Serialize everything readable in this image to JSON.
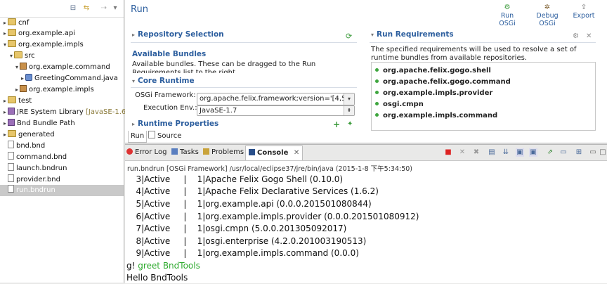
{
  "explorer": {
    "items": [
      {
        "label": "cnf"
      },
      {
        "label": "org.example.api"
      },
      {
        "label": "org.example.impls"
      },
      {
        "label": "src"
      },
      {
        "label": "org.example.command"
      },
      {
        "label": "GreetingCommand.java"
      },
      {
        "label": "org.example.impls"
      },
      {
        "label": "test"
      },
      {
        "label": "JRE System Library",
        "suffix": "[JavaSE-1.6"
      },
      {
        "label": "Bnd Bundle Path"
      },
      {
        "label": "generated"
      },
      {
        "label": "bnd.bnd"
      },
      {
        "label": "command.bnd"
      },
      {
        "label": "launch.bndrun"
      },
      {
        "label": "provider.bnd"
      },
      {
        "label": "run.bndrun"
      }
    ]
  },
  "editor": {
    "title": "Run",
    "buttons": {
      "run": "Run OSGi",
      "debug": "Debug OSGi",
      "export": "Export"
    },
    "repository_selection": "Repository Selection",
    "available_bundles_title": "Available Bundles",
    "available_bundles_desc": "Available bundles. These can be dragged to the Run Requirements list to the right.",
    "core_runtime": "Core Runtime",
    "osgi_framework_label": "OSGi Framework:",
    "osgi_framework_value": "org.apache.felix.framework;version='[4,5)'",
    "execution_env_label": "Execution Env.:",
    "execution_env_value": "JavaSE-1.7",
    "runtime_properties": "Runtime Properties",
    "run_requirements": "Run Requirements",
    "run_requirements_desc": "The specified requirements will be used to resolve a set of runtime bundles from available repositories.",
    "requirements": [
      "org.apache.felix.gogo.shell",
      "org.apache.felix.gogo.command",
      "org.example.impls.provider",
      "osgi.cmpn",
      "org.example.impls.command"
    ],
    "tabs": {
      "run": "Run",
      "source": "Source"
    }
  },
  "console": {
    "tabs": {
      "error_log": "Error Log",
      "tasks": "Tasks",
      "problems": "Problems",
      "console": "Console"
    },
    "process": "run.bndrun [OSGi Framework] /usr/local/eclipse37/jre/bin/java (2015-1-8 下午5:34:50)",
    "lines": [
      "   3|Active     |    1|Apache Felix Gogo Shell (0.10.0)",
      "   4|Active     |    1|Apache Felix Declarative Services (1.6.2)",
      "   5|Active     |    1|org.example.api (0.0.0.201501080844)",
      "   6|Active     |    1|org.example.impls.provider (0.0.0.201501080912)",
      "   7|Active     |    1|osgi.cmpn (5.0.0.201305092017)",
      "   8|Active     |    1|osgi.enterprise (4.2.0.201003190513)",
      "   9|Active     |    1|org.example.impls.command (0.0.0)"
    ],
    "prompt": "g! ",
    "command": "greet BndTools",
    "response": "Hello BndTools"
  }
}
